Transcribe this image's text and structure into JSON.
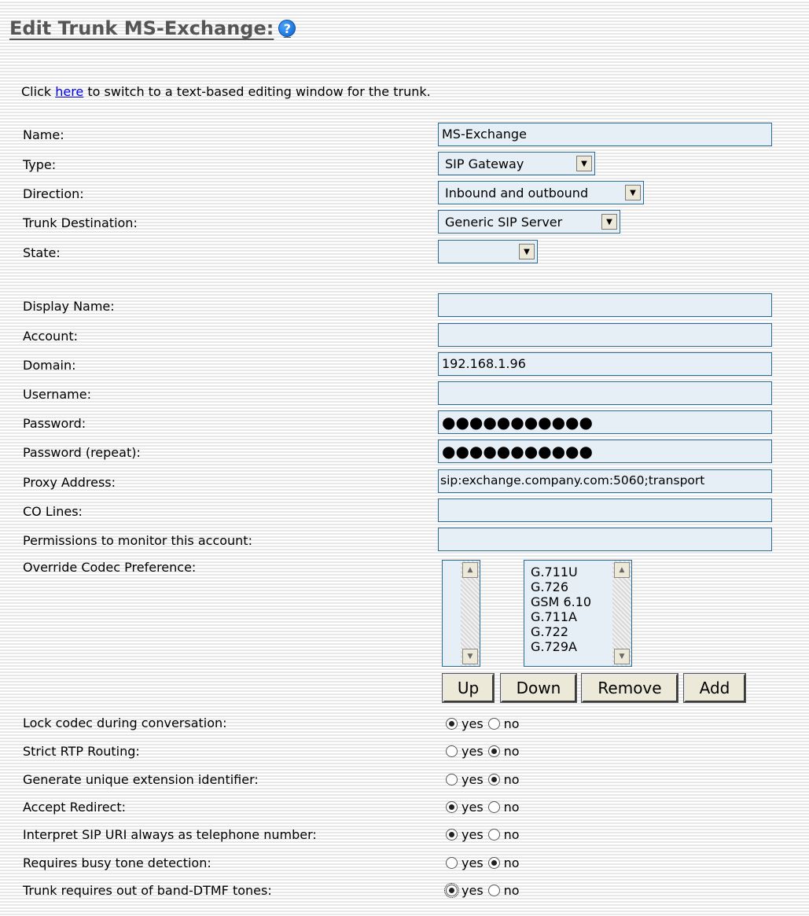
{
  "page_title": "Edit Trunk MS-Exchange:",
  "intro": {
    "before": "Click ",
    "link": "here",
    "after": " to switch to a text-based editing window for the trunk."
  },
  "fields": {
    "name": {
      "label": "Name:",
      "value": "MS-Exchange"
    },
    "type": {
      "label": "Type:",
      "value": "SIP Gateway"
    },
    "direction": {
      "label": "Direction:",
      "value": "Inbound and outbound"
    },
    "trunk_destination": {
      "label": "Trunk Destination:",
      "value": "Generic SIP Server"
    },
    "state": {
      "label": "State:",
      "value": ""
    },
    "display_name": {
      "label": "Display Name:",
      "value": ""
    },
    "account": {
      "label": "Account:",
      "value": ""
    },
    "domain": {
      "label": "Domain:",
      "value": "192.168.1.96"
    },
    "username": {
      "label": "Username:",
      "value": ""
    },
    "password": {
      "label": "Password:",
      "value": "●●●●●●●●●●●"
    },
    "password_repeat": {
      "label": "Password (repeat):",
      "value": "●●●●●●●●●●●"
    },
    "proxy_address": {
      "label": "Proxy Address:",
      "value": "sip:exchange.company.com:5060;transport"
    },
    "co_lines": {
      "label": "CO Lines:",
      "value": ""
    },
    "permissions": {
      "label": "Permissions to monitor this account:",
      "value": ""
    },
    "codec_pref": {
      "label": "Override Codec Preference:"
    }
  },
  "codecs_available": [
    "G.711U",
    "G.726",
    "GSM 6.10",
    "G.711A",
    "G.722",
    "G.729A"
  ],
  "buttons": {
    "up": "Up",
    "down": "Down",
    "remove": "Remove",
    "add": "Add"
  },
  "radio_labels": {
    "yes": "yes",
    "no": "no"
  },
  "options": [
    {
      "label": "Lock codec during conversation:",
      "selected": "yes"
    },
    {
      "label": "Strict RTP Routing:",
      "selected": "no"
    },
    {
      "label": "Generate unique extension identifier:",
      "selected": "no"
    },
    {
      "label": "Accept Redirect:",
      "selected": "yes"
    },
    {
      "label": "Interpret SIP URI always as telephone number:",
      "selected": "yes"
    },
    {
      "label": "Requires busy tone detection:",
      "selected": "no"
    },
    {
      "label": "Trunk requires out of band-DTMF tones:",
      "selected": "yes"
    }
  ],
  "colors": {
    "field_bg": "#e6eef6",
    "field_border": "#2a6b93",
    "title": "#555555",
    "link": "#0000ee"
  }
}
